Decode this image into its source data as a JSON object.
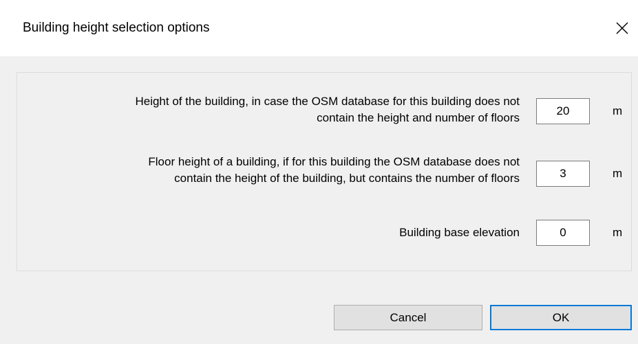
{
  "window": {
    "title": "Building height selection options",
    "close_symbol": "×"
  },
  "rows": [
    {
      "label_line1": "Height of the building, in case the OSM database for this building does not",
      "label_line2": "contain the height and number of floors",
      "value": "20",
      "unit": "m"
    },
    {
      "label_line1": "Floor height of a building, if for this building the OSM database does not",
      "label_line2": "contain the height of the building, but contains the number of floors",
      "value": "3",
      "unit": "m"
    },
    {
      "label_line1": "Building base elevation",
      "value": "0",
      "unit": "m"
    }
  ],
  "buttons": {
    "cancel_label": "Cancel",
    "ok_label": "OK"
  },
  "icons": {
    "close": "close-icon"
  },
  "colors": {
    "accent": "#0078d7",
    "background": "#f0f0f0",
    "titlebar": "#ffffff"
  }
}
